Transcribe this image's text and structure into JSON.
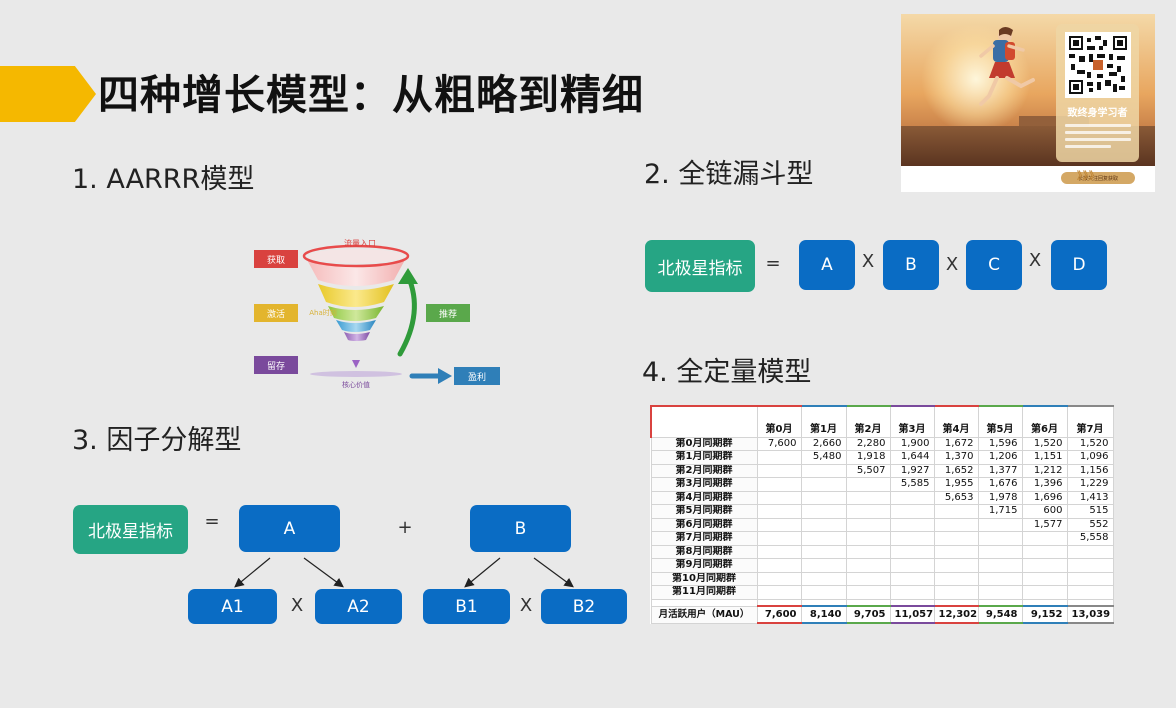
{
  "page": {
    "title": "四种增长模型：从粗略到精细",
    "accent_color": "#f5b800"
  },
  "promo": {
    "qr_icon": "qr-code-icon",
    "card_title": "致终身学习者",
    "footer_button": "长按关注回复获取",
    "arrows": "》》》"
  },
  "section1": {
    "title": "1. AARRR模型",
    "funnel": {
      "top_label": "流量入口",
      "middle_label": "Aha时刻",
      "bottom_label": "核心价值",
      "stages": [
        {
          "label": "获取",
          "color": "#d9423f"
        },
        {
          "label": "激活",
          "color": "#e3b52d"
        },
        {
          "label": "留存",
          "color": "#7a4a9c"
        },
        {
          "label": "推荐",
          "color": "#5aa84b"
        },
        {
          "label": "盈利",
          "color": "#2f7fb8"
        }
      ]
    }
  },
  "section2": {
    "title": "2. 全链漏斗型",
    "north_star": "北极星指标",
    "equals": "=",
    "factors": [
      "A",
      "B",
      "C",
      "D"
    ],
    "operator": "X"
  },
  "section3": {
    "title": "3. 因子分解型",
    "north_star": "北极星指标",
    "equals": "=",
    "plus": "+",
    "times": "X",
    "a": "A",
    "b": "B",
    "a_children": [
      "A1",
      "A2"
    ],
    "b_children": [
      "B1",
      "B2"
    ]
  },
  "section4": {
    "title": "4. 全定量模型",
    "table": {
      "columns": [
        "第0月",
        "第1月",
        "第2月",
        "第3月",
        "第4月",
        "第5月",
        "第6月",
        "第7月"
      ],
      "column_colors": [
        "#d9423f",
        "#2f7fb8",
        "#5aa84b",
        "#7a4a9c",
        "#d9423f",
        "#5aa84b",
        "#2f7fb8",
        "#888888"
      ],
      "rows": [
        {
          "label": "第0月同期群",
          "values": [
            "7,600",
            "2,660",
            "2,280",
            "1,900",
            "1,672",
            "1,596",
            "1,520",
            "1,520"
          ]
        },
        {
          "label": "第1月同期群",
          "values": [
            "",
            "5,480",
            "1,918",
            "1,644",
            "1,370",
            "1,206",
            "1,151",
            "1,096"
          ]
        },
        {
          "label": "第2月同期群",
          "values": [
            "",
            "",
            "5,507",
            "1,927",
            "1,652",
            "1,377",
            "1,212",
            "1,156"
          ]
        },
        {
          "label": "第3月同期群",
          "values": [
            "",
            "",
            "",
            "5,585",
            "1,955",
            "1,676",
            "1,396",
            "1,229"
          ]
        },
        {
          "label": "第4月同期群",
          "values": [
            "",
            "",
            "",
            "",
            "5,653",
            "1,978",
            "1,696",
            "1,413"
          ]
        },
        {
          "label": "第5月同期群",
          "values": [
            "",
            "",
            "",
            "",
            "",
            "1,715",
            "600",
            "515"
          ]
        },
        {
          "label": "第6月同期群",
          "values": [
            "",
            "",
            "",
            "",
            "",
            "",
            "1,577",
            "552"
          ]
        },
        {
          "label": "第7月同期群",
          "values": [
            "",
            "",
            "",
            "",
            "",
            "",
            "",
            "5,558"
          ]
        },
        {
          "label": "第8月同期群",
          "values": [
            "",
            "",
            "",
            "",
            "",
            "",
            "",
            ""
          ]
        },
        {
          "label": "第9月同期群",
          "values": [
            "",
            "",
            "",
            "",
            "",
            "",
            "",
            ""
          ]
        },
        {
          "label": "第10月同期群",
          "values": [
            "",
            "",
            "",
            "",
            "",
            "",
            "",
            ""
          ]
        },
        {
          "label": "第11月同期群",
          "values": [
            "",
            "",
            "",
            "",
            "",
            "",
            "",
            ""
          ]
        }
      ],
      "footer": {
        "label": "月活跃用户（MAU）",
        "values": [
          "7,600",
          "8,140",
          "9,705",
          "11,057",
          "12,302",
          "9,548",
          "9,152",
          "13,039"
        ]
      }
    }
  }
}
